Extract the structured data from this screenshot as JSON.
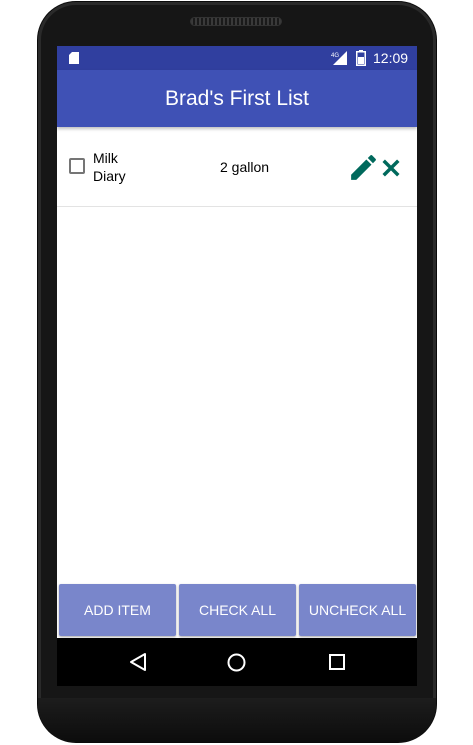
{
  "status_bar": {
    "time": "12:09",
    "network": "4G",
    "icons": [
      "sd-card-icon",
      "signal-icon",
      "battery-icon"
    ]
  },
  "app_bar": {
    "title": "Brad's First List"
  },
  "list": {
    "items": [
      {
        "name_line1": "Milk",
        "name_line2": "Diary",
        "quantity": "2 gallon",
        "checked": false,
        "actions": [
          "edit-icon",
          "delete-icon"
        ]
      }
    ]
  },
  "buttons": {
    "add_item": "ADD ITEM",
    "check_all": "CHECK ALL",
    "uncheck_all": "UNCHECK ALL"
  },
  "nav_bar": {
    "icons": [
      "back-icon",
      "home-icon",
      "recents-icon"
    ]
  },
  "colors": {
    "status_bar": "#303f9f",
    "app_bar": "#3f51b5",
    "button": "#7986cb",
    "action_icon": "#00695c"
  }
}
